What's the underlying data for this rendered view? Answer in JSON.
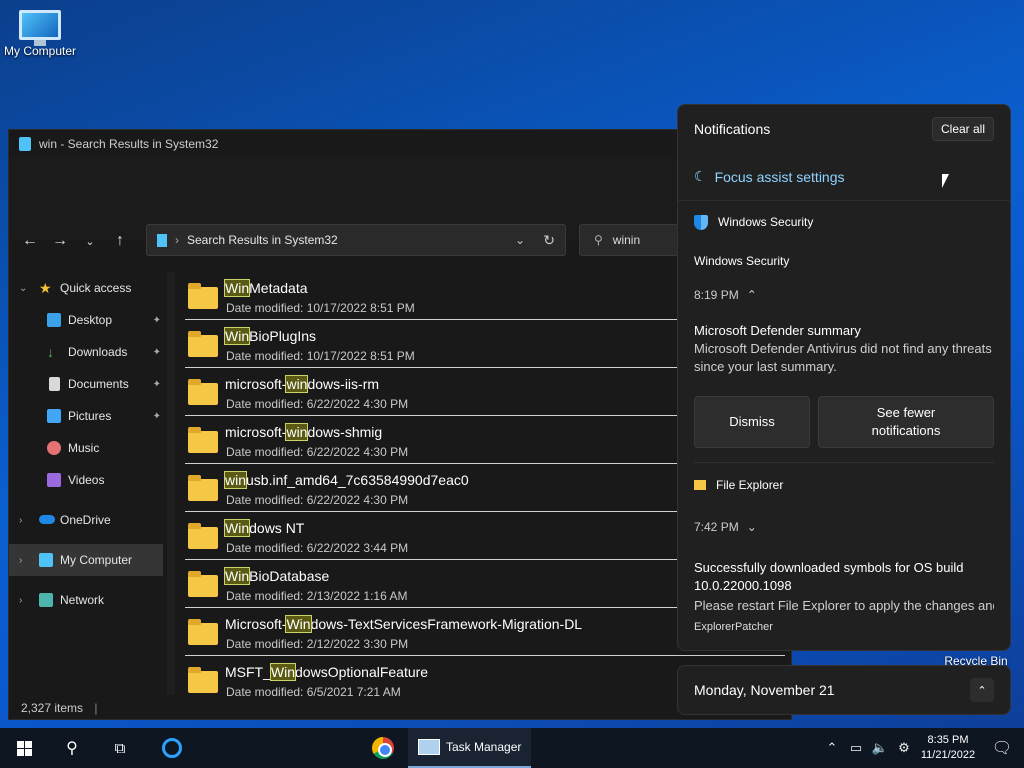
{
  "desktop": {
    "icons": [
      {
        "label": "My Computer"
      },
      {
        "label": "Recycle Bin"
      }
    ]
  },
  "explorer": {
    "title": "win - Search Results in System32",
    "address": "Search Results in System32",
    "search_value": "winin",
    "sidebar": [
      {
        "label": "Quick access"
      },
      {
        "label": "Desktop"
      },
      {
        "label": "Downloads"
      },
      {
        "label": "Documents"
      },
      {
        "label": "Pictures"
      },
      {
        "label": "Music"
      },
      {
        "label": "Videos"
      },
      {
        "label": "OneDrive"
      },
      {
        "label": "My Computer"
      },
      {
        "label": "Network"
      }
    ],
    "files": [
      {
        "pre": "",
        "hl": "Win",
        "post": "Metadata",
        "date": "Date modified: 10/17/2022 8:51 PM"
      },
      {
        "pre": "",
        "hl": "Win",
        "post": "BioPlugIns",
        "date": "Date modified: 10/17/2022 8:51 PM"
      },
      {
        "pre": "microsoft-",
        "hl": "win",
        "post": "dows-iis-rm",
        "date": "Date modified: 6/22/2022 4:30 PM"
      },
      {
        "pre": "microsoft-",
        "hl": "win",
        "post": "dows-shmig",
        "date": "Date modified: 6/22/2022 4:30 PM"
      },
      {
        "pre": "",
        "hl": "win",
        "post": "usb.inf_amd64_7c63584990d7eac0",
        "date": "Date modified: 6/22/2022 4:30 PM"
      },
      {
        "pre": "",
        "hl": "Win",
        "post": "dows NT",
        "date": "Date modified: 6/22/2022 3:44 PM"
      },
      {
        "pre": "",
        "hl": "Win",
        "post": "BioDatabase",
        "date": "Date modified: 2/13/2022 1:16 AM"
      },
      {
        "pre": "Microsoft-",
        "hl": "Win",
        "post": "dows-TextServicesFramework-Migration-DL",
        "date": "Date modified: 2/12/2022 3:30 PM"
      },
      {
        "pre": "MSFT_",
        "hl": "Win",
        "post": "dowsOptionalFeature",
        "date": "Date modified: 6/5/2021 7:21 AM"
      }
    ],
    "status": "2,327 items"
  },
  "notifications": {
    "title": "Notifications",
    "clear_all": "Clear all",
    "focus_assist": "Focus assist settings",
    "security": {
      "app": "Windows Security",
      "group": "Windows Security",
      "time": "8:19 PM",
      "msg_title": "Microsoft Defender summary",
      "msg_body": "Microsoft Defender Antivirus did not find any threats since your last summary.",
      "dismiss": "Dismiss",
      "see_fewer": "See fewer notifications"
    },
    "file_explorer": {
      "app": "File Explorer",
      "time": "7:42 PM",
      "msg_title": "Successfully downloaded symbols for OS build 10.0.22000.1098",
      "msg_body": "Please restart File Explorer to apply the changes and",
      "source": "ExplorerPatcher"
    }
  },
  "calendar": {
    "date": "Monday, November 21"
  },
  "taskbar": {
    "task_manager": "Task Manager",
    "time": "8:35 PM",
    "date": "11/21/2022"
  }
}
